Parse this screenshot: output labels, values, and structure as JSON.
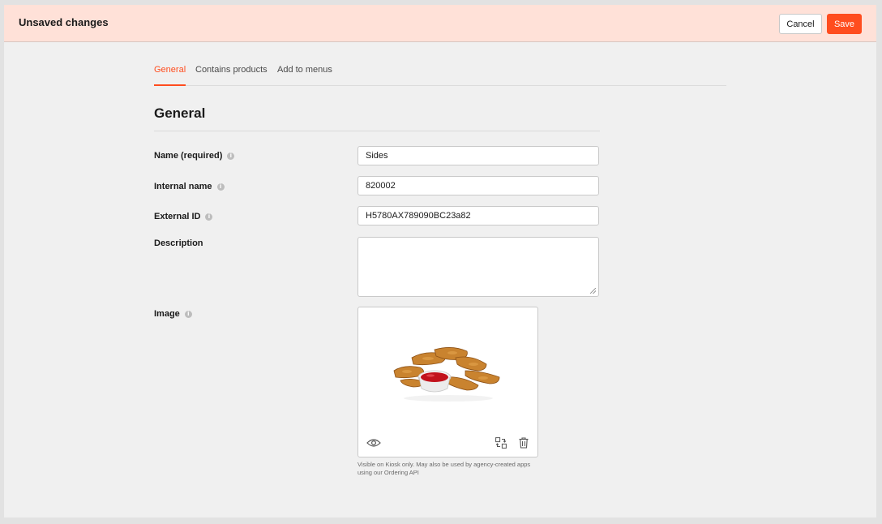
{
  "header": {
    "title": "Unsaved changes",
    "cancel_label": "Cancel",
    "save_label": "Save"
  },
  "tabs": [
    {
      "label": "General",
      "active": true
    },
    {
      "label": "Contains products",
      "active": false
    },
    {
      "label": "Add to menus",
      "active": false
    }
  ],
  "section": {
    "title": "General"
  },
  "fields": {
    "name": {
      "label": "Name (required)",
      "value": "Sides"
    },
    "internal_name": {
      "label": "Internal name",
      "value": "820002"
    },
    "external_id": {
      "label": "External ID",
      "value": "H5780AX789090BC23a82"
    },
    "description": {
      "label": "Description",
      "value": ""
    },
    "image": {
      "label": "Image",
      "helper": "Visible on Kiosk only. May also be used by agency-created apps using our Ordering API"
    }
  },
  "icons": {
    "info": "info-icon",
    "preview": "eye-icon",
    "replace": "replace-image-icon",
    "delete": "trash-icon"
  },
  "colors": {
    "accent": "#ff4d1f",
    "unsaved_bar": "#ffe1d8",
    "background": "#f0f0f0"
  }
}
